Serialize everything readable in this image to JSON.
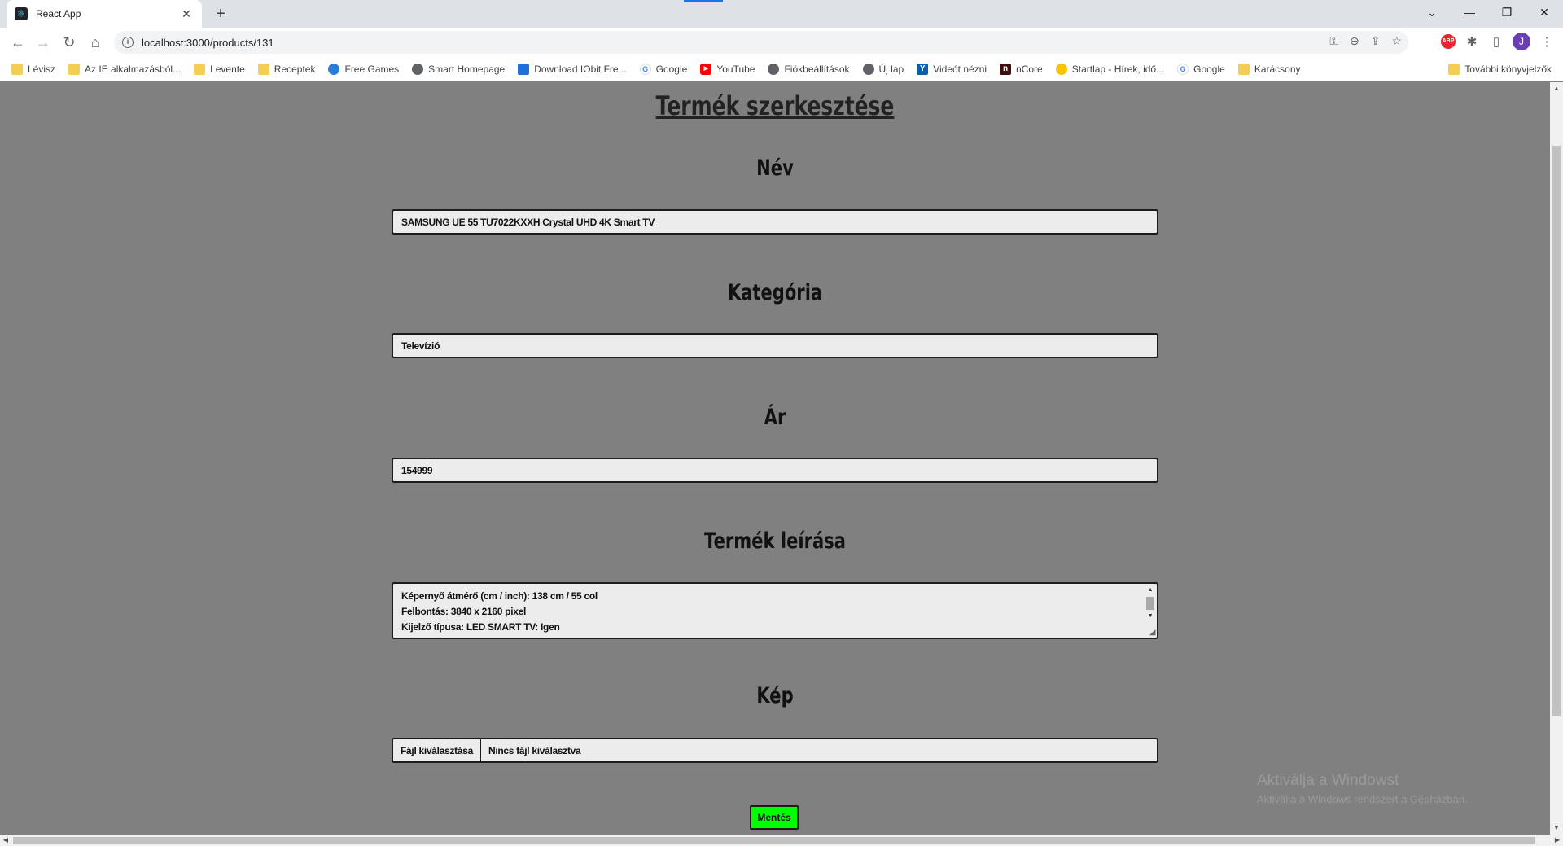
{
  "browser": {
    "tab_title": "React App",
    "tab_close": "✕",
    "new_tab": "+",
    "url": "localhost:3000/products/131",
    "window_controls": {
      "minimize": "—",
      "restore": "❐",
      "close": "✕",
      "tab_list": "⌄"
    },
    "nav": {
      "back": "←",
      "forward": "→",
      "reload": "↻",
      "home": "⌂"
    },
    "omnibox_icons": {
      "key": "⚿",
      "zoom": "⊖",
      "share": "⇪",
      "star": "☆"
    },
    "extensions": {
      "abp": "ABP",
      "puzzle": "✱",
      "sidepanel": "▯",
      "avatar": "J",
      "menu": "⋮"
    },
    "accent_color": "#1a73e8"
  },
  "bookmarks": {
    "items": [
      {
        "label": "Lévisz",
        "icon": "folder-icon"
      },
      {
        "label": "Az IE alkalmazásból...",
        "icon": "folder-icon"
      },
      {
        "label": "Levente",
        "icon": "folder-icon"
      },
      {
        "label": "Receptek",
        "icon": "folder-icon"
      },
      {
        "label": "Free Games",
        "icon": "free-games-icon"
      },
      {
        "label": "Smart Homepage",
        "icon": "globe-icon"
      },
      {
        "label": "Download IObit Fre...",
        "icon": "iobit-icon"
      },
      {
        "label": "Google",
        "icon": "google-icon"
      },
      {
        "label": "YouTube",
        "icon": "youtube-icon"
      },
      {
        "label": "Fiókbeállítások",
        "icon": "globe-icon"
      },
      {
        "label": "Új lap",
        "icon": "globe-icon"
      },
      {
        "label": "Videót nézni",
        "icon": "y-icon"
      },
      {
        "label": "nCore",
        "icon": "ncore-icon"
      },
      {
        "label": "Startlap - Hírek, idő...",
        "icon": "startlap-icon"
      },
      {
        "label": "Google",
        "icon": "google-icon"
      },
      {
        "label": "Karácsony",
        "icon": "folder-icon"
      }
    ],
    "other": "További könyvjelzők"
  },
  "page": {
    "title": "Termék szerkesztése",
    "name_label": "Név",
    "name_value": "SAMSUNG UE 55 TU7022KXXH Crystal UHD 4K Smart TV",
    "category_label": "Kategória",
    "category_value": "Televízió",
    "price_label": "Ár",
    "price_value": "154999",
    "description_label": "Termék leírása",
    "description_lines": [
      "Képernyő átmérő (cm / inch): 138 cm / 55 col",
      "Felbontás: 3840 x 2160 pixel",
      "Kijelző típusa: LED SMART TV: Igen"
    ],
    "image_label": "Kép",
    "file_button": "Fájl kiválasztása",
    "file_status": "Nincs fájl kiválasztva",
    "save_button": "Mentés",
    "save_color": "#00ff00"
  },
  "watermark": {
    "line1": "Aktiválja a Windowst",
    "line2": "Aktiválja a Windows rendszert a Gépházban."
  }
}
